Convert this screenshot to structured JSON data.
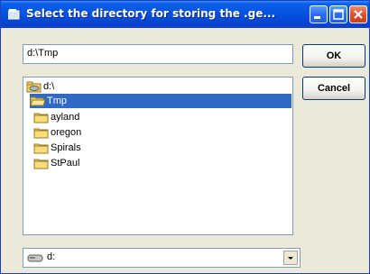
{
  "window": {
    "title": "Select the directory for storing the .ge...",
    "minimize_icon": "minimize-icon",
    "maximize_icon": "maximize-icon",
    "close_icon": "close-icon"
  },
  "path_field": {
    "value": "d:\\Tmp"
  },
  "buttons": {
    "ok": "OK",
    "cancel": "Cancel"
  },
  "directories": [
    {
      "label": "d:\\",
      "icon": "drive-folder-icon",
      "level": 0,
      "selected": false
    },
    {
      "label": "Tmp",
      "icon": "open-folder-icon",
      "level": 1,
      "selected": true
    },
    {
      "label": "ayland",
      "icon": "folder-icon",
      "level": 2,
      "selected": false
    },
    {
      "label": "oregon",
      "icon": "folder-icon",
      "level": 2,
      "selected": false
    },
    {
      "label": "Spirals",
      "icon": "folder-icon",
      "level": 2,
      "selected": false
    },
    {
      "label": "StPaul",
      "icon": "folder-icon",
      "level": 2,
      "selected": false
    }
  ],
  "drive_select": {
    "value": "d:",
    "icon": "hard-drive-icon"
  },
  "colors": {
    "titlebar": "#0553e0",
    "selection": "#316ac5",
    "face": "#ece9d8"
  }
}
